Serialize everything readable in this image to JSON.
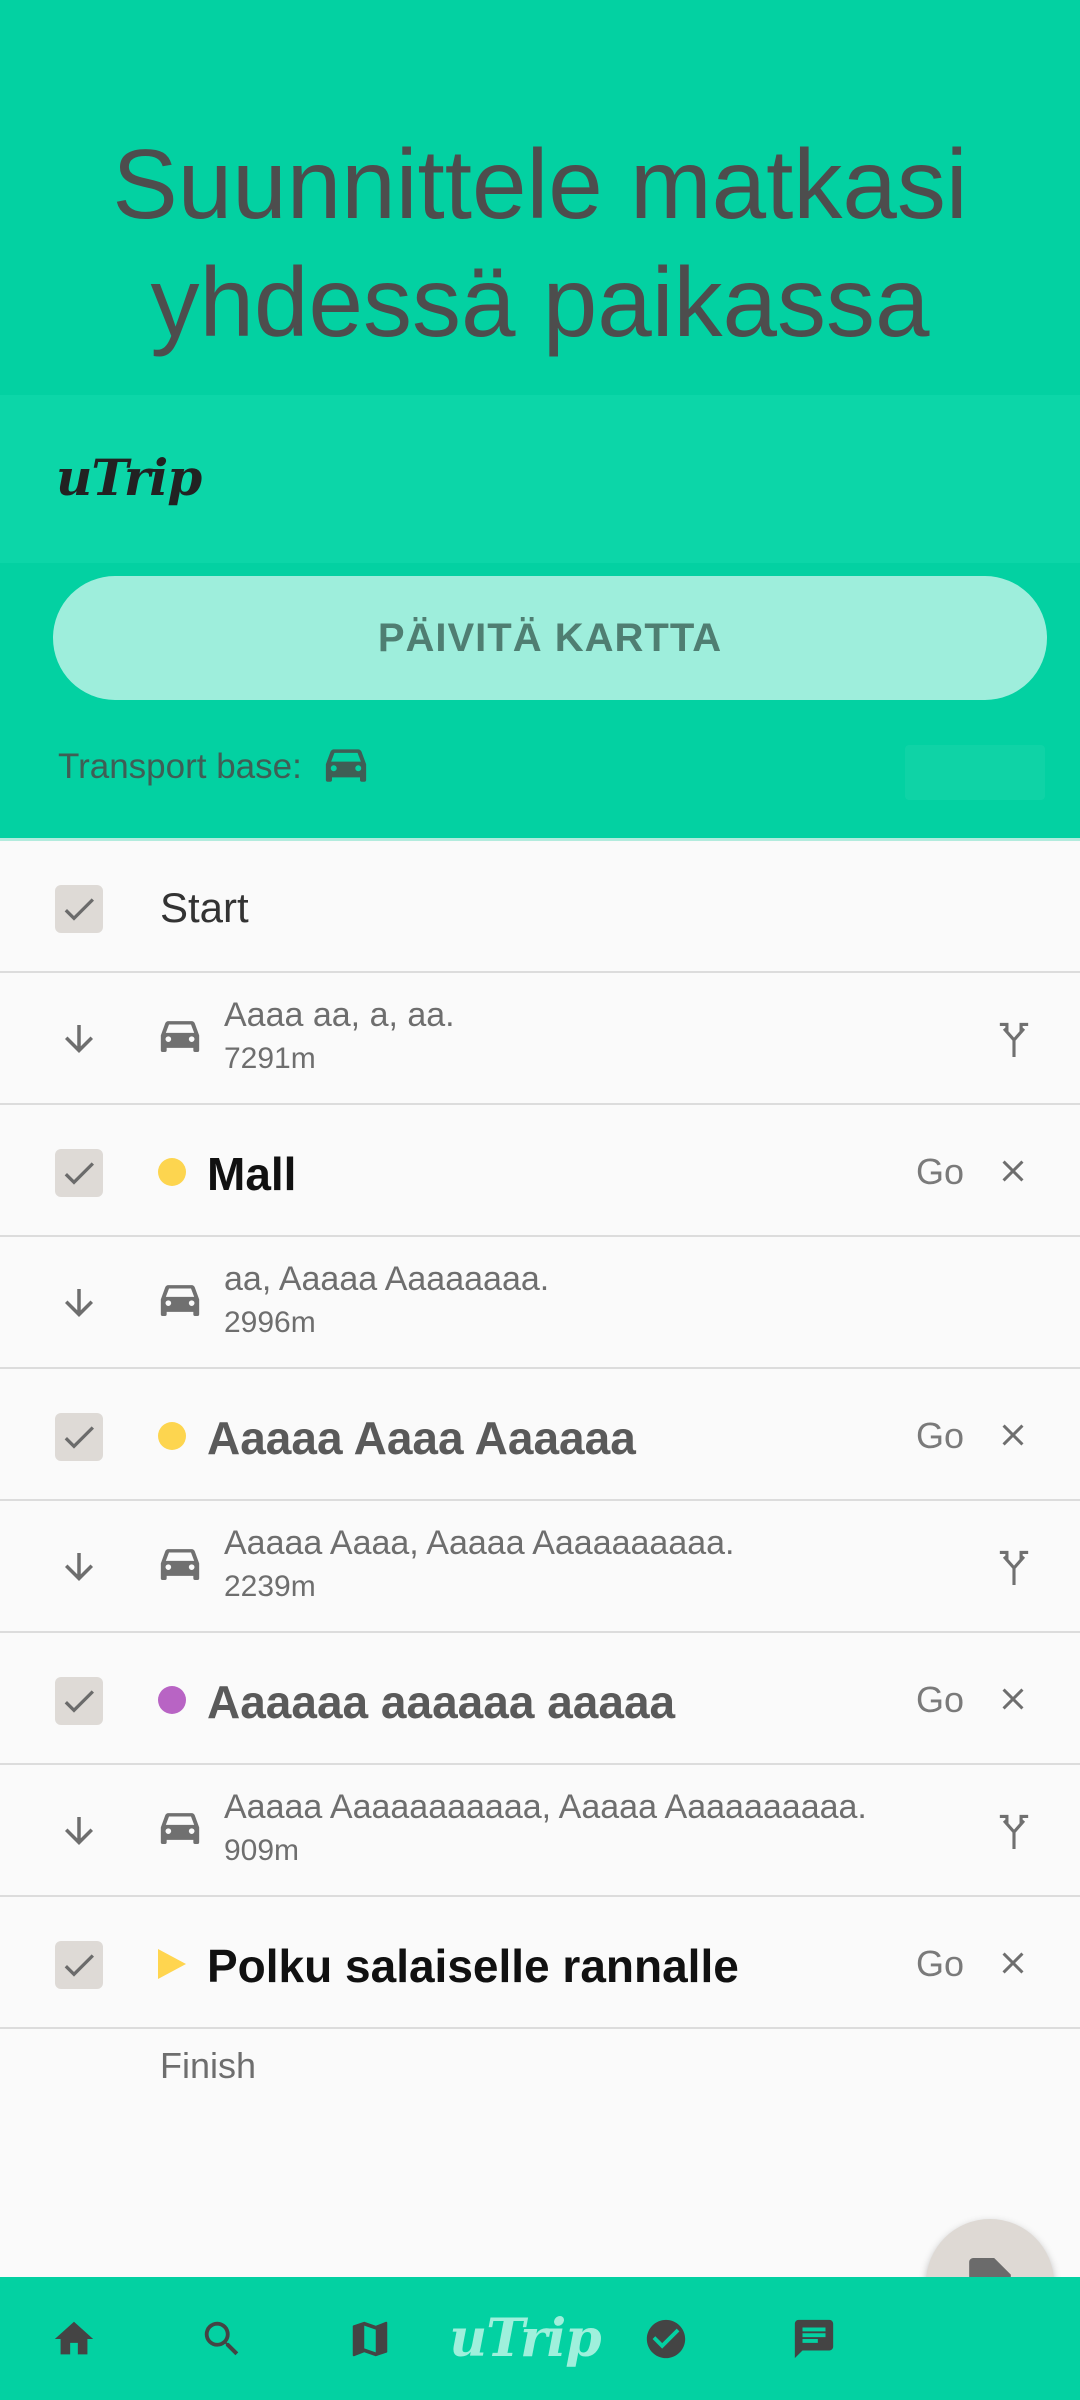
{
  "header": {
    "title_line1": "Suunnittele matkasi",
    "title_line2": "yhdessä paikassa",
    "logo": "uTrip",
    "update_button": "PÄIVITÄ KARTTA",
    "transport_label": "Transport base:",
    "transport_icon": "car-icon"
  },
  "colors": {
    "accent": "#03d1a2",
    "button_bg": "#9eeedc",
    "dot_yellow": "#fdd54f",
    "dot_purple": "#b864c4",
    "text_dark": "#4d4d4d"
  },
  "route": {
    "start_label": "Start",
    "finish_label": "Finish",
    "go_label": "Go",
    "stops": [
      {
        "name": "Mall",
        "marker": "dot",
        "color": "#fdd54f"
      },
      {
        "name": "Aaaaa Aaaa Aaaaaa",
        "marker": "dot",
        "color": "#fdd54f"
      },
      {
        "name": "Aaaaaa aaaaaa aaaaa",
        "marker": "dot",
        "color": "#b864c4"
      },
      {
        "name": "Polku salaiselle rannalle",
        "marker": "triangle",
        "color": "#fdd54f"
      }
    ],
    "segments": [
      {
        "text": "Aaaa aa, a, aa.",
        "distance": "7291m",
        "has_fork": true
      },
      {
        "text": "aa, Aaaaa Aaaaaaaa.",
        "distance": "2996m",
        "has_fork": false
      },
      {
        "text": "Aaaaa Aaaa, Aaaaa Aaaaaaaaaa.",
        "distance": "2239m",
        "has_fork": true
      },
      {
        "text": "Aaaaa Aaaaaaaaaaa, Aaaaa Aaaaaaaaaa.",
        "distance": "909m",
        "has_fork": true
      }
    ]
  },
  "bottom_nav": {
    "items": [
      "home-icon",
      "search-icon",
      "map-icon",
      "uTrip",
      "check-circle-icon",
      "chat-icon"
    ],
    "logo": "uTrip"
  },
  "fab": {
    "icon": "contact-document-icon"
  }
}
